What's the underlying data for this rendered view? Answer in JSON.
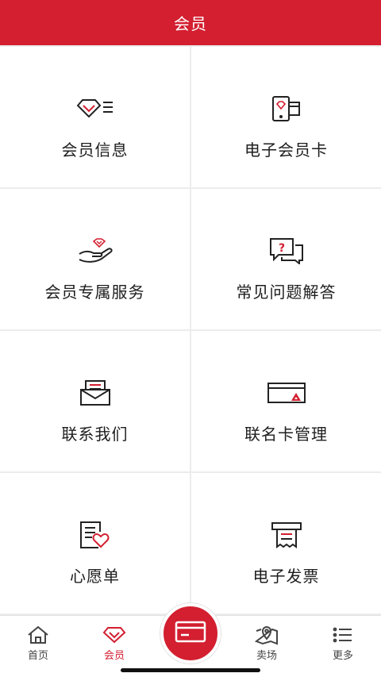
{
  "header": {
    "title": "会员"
  },
  "tiles": [
    {
      "label": "会员信息",
      "icon": "diamond-list-icon"
    },
    {
      "label": "电子会员卡",
      "icon": "phone-card-icon"
    },
    {
      "label": "会员专属服务",
      "icon": "hand-diamond-icon"
    },
    {
      "label": "常见问题解答",
      "icon": "question-chat-icon"
    },
    {
      "label": "联系我们",
      "icon": "mail-icon"
    },
    {
      "label": "联名卡管理",
      "icon": "cobrand-card-icon"
    },
    {
      "label": "心愿单",
      "icon": "wishlist-icon"
    },
    {
      "label": "电子发票",
      "icon": "invoice-icon"
    }
  ],
  "tabbar": {
    "items": [
      {
        "label": "首页",
        "icon": "home-icon"
      },
      {
        "label": "会员",
        "icon": "diamond-icon",
        "active": true
      },
      {
        "label": "",
        "icon": "card-icon"
      },
      {
        "label": "卖场",
        "icon": "map-pin-icon"
      },
      {
        "label": "更多",
        "icon": "list-icon"
      }
    ]
  },
  "colors": {
    "brand": "#d31f30",
    "text": "#1e1e1e",
    "background": "#ececec"
  }
}
